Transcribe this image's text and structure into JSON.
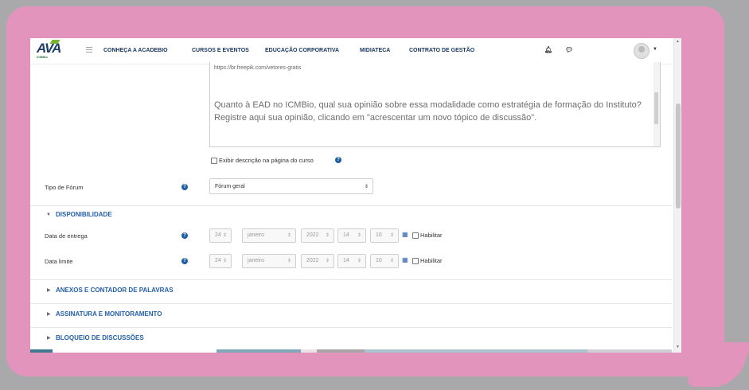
{
  "navbar": {
    "logo_text": "AVA",
    "logo_sub": "ICMBio",
    "items": [
      "CONHEÇA A ACADEBIO",
      "CURSOS E EVENTOS",
      "EDUCAÇÃO CORPORATIVA",
      "MIDIATECA",
      "CONTRATO DE GESTÃO"
    ]
  },
  "editor": {
    "url": "https://br.freepik.com/vetores-gratis",
    "question": "Quanto à EAD no ICMBio, qual sua opinião sobre essa modalidade como estratégia de formação do Instituto? Registre aqui sua opinião, clicando em \"acrescentar um novo tópico de discussão\"."
  },
  "show_description_label": "Exibir descrição na página do curso",
  "forum_type": {
    "label": "Tipo de Fórum",
    "value": "Fórum geral"
  },
  "availability": {
    "title": "DISPONIBILIDADE",
    "rows": [
      {
        "label": "Data de entrega",
        "day": "24",
        "month": "janeiro",
        "year": "2022",
        "hour": "14",
        "minute": "10",
        "enable_label": "Habilitar"
      },
      {
        "label": "Data limite",
        "day": "24",
        "month": "janeiro",
        "year": "2022",
        "hour": "14",
        "minute": "10",
        "enable_label": "Habilitar"
      }
    ]
  },
  "sections": [
    "ANEXOS E CONTADOR DE PALAVRAS",
    "ASSINATURA E MONITORAMENTO",
    "BLOQUEIO DE DISCUSSÕES"
  ],
  "help_glyph": "?",
  "colors": {
    "bubble": "#e394bd",
    "link": "#2460a8",
    "help": "#1e5fa0"
  }
}
